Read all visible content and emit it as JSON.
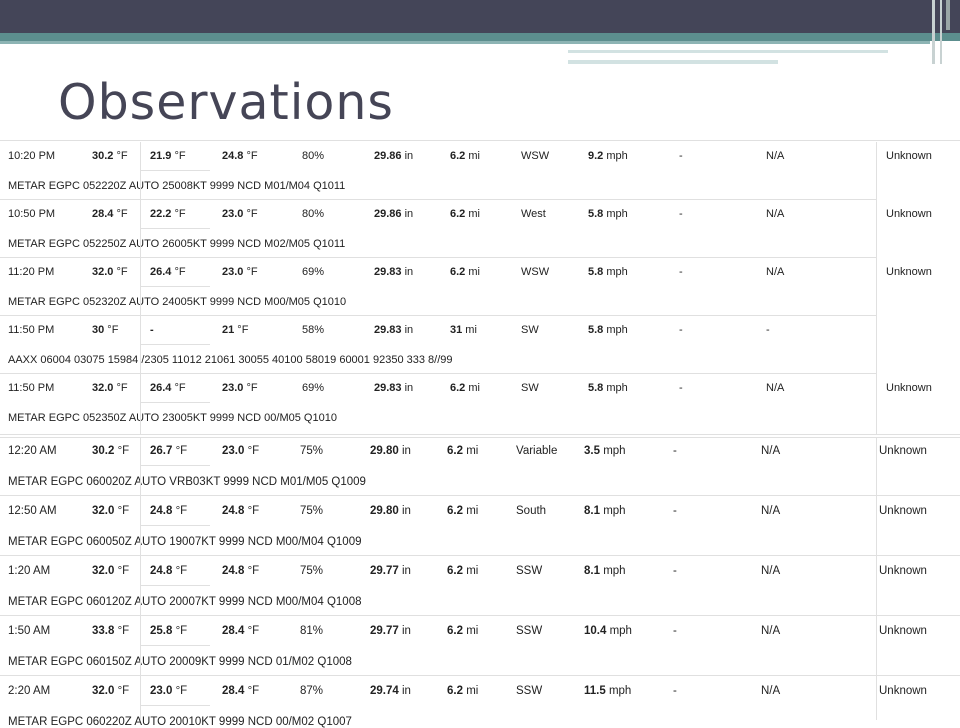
{
  "title": "Observations",
  "rows1": [
    {
      "time": "10:20 PM",
      "temp": [
        "30.2",
        " °F"
      ],
      "windchill": [
        "21.9",
        " °F"
      ],
      "dewpoint": [
        "24.8",
        " °F"
      ],
      "humidity": "80%",
      "pressure": [
        "29.86",
        " in"
      ],
      "visibility": [
        "6.2",
        " mi"
      ],
      "wind_dir": "WSW",
      "wind_speed": [
        "9.2",
        " mph"
      ],
      "gust": "-",
      "precip": "N/A",
      "events": "Unknown",
      "metar": "METAR EGPC 052220Z AUTO 25008KT 9999 NCD M01/M04 Q1011"
    },
    {
      "time": "10:50 PM",
      "temp": [
        "28.4",
        " °F"
      ],
      "windchill": [
        "22.2",
        " °F"
      ],
      "dewpoint": [
        "23.0",
        " °F"
      ],
      "humidity": "80%",
      "pressure": [
        "29.86",
        " in"
      ],
      "visibility": [
        "6.2",
        " mi"
      ],
      "wind_dir": "West",
      "wind_speed": [
        "5.8",
        " mph"
      ],
      "gust": "-",
      "precip": "N/A",
      "events": "Unknown",
      "metar": "METAR EGPC 052250Z AUTO 26005KT 9999 NCD M02/M05 Q1011"
    },
    {
      "time": "11:20 PM",
      "temp": [
        "32.0",
        " °F"
      ],
      "windchill": [
        "26.4",
        " °F"
      ],
      "dewpoint": [
        "23.0",
        " °F"
      ],
      "humidity": "69%",
      "pressure": [
        "29.83",
        " in"
      ],
      "visibility": [
        "6.2",
        " mi"
      ],
      "wind_dir": "WSW",
      "wind_speed": [
        "5.8",
        " mph"
      ],
      "gust": "-",
      "precip": "N/A",
      "events": "Unknown",
      "metar": "METAR EGPC 052320Z AUTO 24005KT 9999 NCD M00/M05 Q1010"
    },
    {
      "time": "11:50 PM",
      "temp": [
        "30",
        " °F"
      ],
      "windchill": [
        "-",
        ""
      ],
      "dewpoint": [
        "21",
        " °F"
      ],
      "humidity": "58%",
      "pressure": [
        "29.83",
        " in"
      ],
      "visibility": [
        "31",
        " mi"
      ],
      "wind_dir": "SW",
      "wind_speed": [
        "5.8",
        " mph"
      ],
      "gust": "-",
      "precip": "-",
      "events": "",
      "metar": "AAXX 06004 03075 15984 /2305 11012 21061 30055 40100 58019 60001 92350 333 8//99"
    },
    {
      "time": "11:50 PM",
      "temp": [
        "32.0",
        " °F"
      ],
      "windchill": [
        "26.4",
        " °F"
      ],
      "dewpoint": [
        "23.0",
        " °F"
      ],
      "humidity": "69%",
      "pressure": [
        "29.83",
        " in"
      ],
      "visibility": [
        "6.2",
        " mi"
      ],
      "wind_dir": "SW",
      "wind_speed": [
        "5.8",
        " mph"
      ],
      "gust": "-",
      "precip": "N/A",
      "events": "Unknown",
      "metar": "METAR EGPC 052350Z AUTO 23005KT 9999 NCD 00/M05 Q1010"
    }
  ],
  "rows2": [
    {
      "time": "12:20 AM",
      "temp": [
        "30.2",
        " °F"
      ],
      "windchill": [
        "26.7",
        " °F"
      ],
      "dewpoint": [
        "23.0",
        " °F"
      ],
      "humidity": "75%",
      "pressure": [
        "29.80",
        " in"
      ],
      "visibility": [
        "6.2",
        " mi"
      ],
      "wind_dir": "Variable",
      "wind_speed": [
        "3.5",
        " mph"
      ],
      "gust": "-",
      "precip": "N/A",
      "events": "Unknown",
      "metar": "METAR EGPC 060020Z AUTO VRB03KT 9999 NCD M01/M05 Q1009"
    },
    {
      "time": "12:50 AM",
      "temp": [
        "32.0",
        " °F"
      ],
      "windchill": [
        "24.8",
        " °F"
      ],
      "dewpoint": [
        "24.8",
        " °F"
      ],
      "humidity": "75%",
      "pressure": [
        "29.80",
        " in"
      ],
      "visibility": [
        "6.2",
        " mi"
      ],
      "wind_dir": "South",
      "wind_speed": [
        "8.1",
        " mph"
      ],
      "gust": "-",
      "precip": "N/A",
      "events": "Unknown",
      "metar": "METAR EGPC 060050Z AUTO 19007KT 9999 NCD M00/M04 Q1009"
    },
    {
      "time": "1:20 AM",
      "temp": [
        "32.0",
        " °F"
      ],
      "windchill": [
        "24.8",
        " °F"
      ],
      "dewpoint": [
        "24.8",
        " °F"
      ],
      "humidity": "75%",
      "pressure": [
        "29.77",
        " in"
      ],
      "visibility": [
        "6.2",
        " mi"
      ],
      "wind_dir": "SSW",
      "wind_speed": [
        "8.1",
        " mph"
      ],
      "gust": "-",
      "precip": "N/A",
      "events": "Unknown",
      "metar": "METAR EGPC 060120Z AUTO 20007KT 9999 NCD M00/M04 Q1008"
    },
    {
      "time": "1:50 AM",
      "temp": [
        "33.8",
        " °F"
      ],
      "windchill": [
        "25.8",
        " °F"
      ],
      "dewpoint": [
        "28.4",
        " °F"
      ],
      "humidity": "81%",
      "pressure": [
        "29.77",
        " in"
      ],
      "visibility": [
        "6.2",
        " mi"
      ],
      "wind_dir": "SSW",
      "wind_speed": [
        "10.4",
        " mph"
      ],
      "gust": "-",
      "precip": "N/A",
      "events": "Unknown",
      "metar": "METAR EGPC 060150Z AUTO 20009KT 9999 NCD 01/M02 Q1008"
    },
    {
      "time": "2:20 AM",
      "temp": [
        "32.0",
        " °F"
      ],
      "windchill": [
        "23.0",
        " °F"
      ],
      "dewpoint": [
        "28.4",
        " °F"
      ],
      "humidity": "87%",
      "pressure": [
        "29.74",
        " in"
      ],
      "visibility": [
        "6.2",
        " mi"
      ],
      "wind_dir": "SSW",
      "wind_speed": [
        "11.5",
        " mph"
      ],
      "gust": "-",
      "precip": "N/A",
      "events": "Unknown",
      "metar": "METAR EGPC 060220Z AUTO 20010KT 9999 NCD 00/M02 Q1007"
    }
  ]
}
